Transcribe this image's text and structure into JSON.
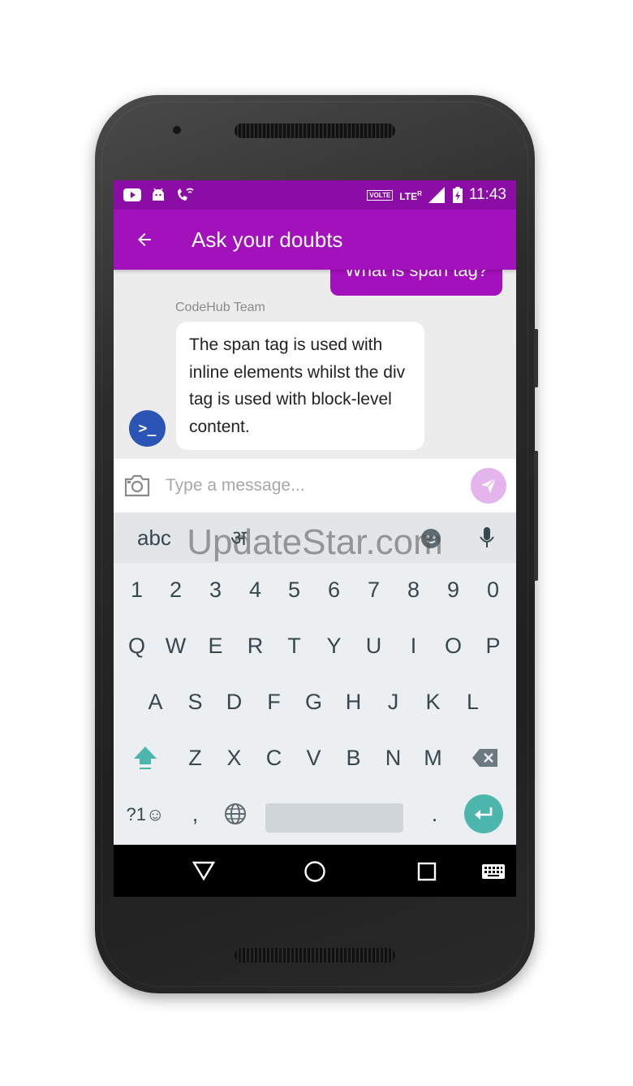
{
  "status_bar": {
    "left_icons": [
      "youtube-icon",
      "android-icon",
      "wifi-calling-icon"
    ],
    "volte": "VOLTE",
    "network": "LTE",
    "roaming": "R",
    "time": "11:43"
  },
  "app_bar": {
    "title": "Ask your doubts"
  },
  "chat": {
    "outgoing_message": "What is span tag?",
    "sender_name": "CodeHub Team",
    "incoming_message": "The span tag is used with inline elements whilst the div tag is used with block-level content.",
    "avatar_symbol": ">_"
  },
  "input": {
    "placeholder": "Type a message..."
  },
  "keyboard": {
    "toolbar": {
      "abc": "abc",
      "hindi": "अ"
    },
    "watermark": "UpdateStar.com",
    "number_row": [
      "1",
      "2",
      "3",
      "4",
      "5",
      "6",
      "7",
      "8",
      "9",
      "0"
    ],
    "row1": [
      "Q",
      "W",
      "E",
      "R",
      "T",
      "Y",
      "U",
      "I",
      "O",
      "P"
    ],
    "row2": [
      "A",
      "S",
      "D",
      "F",
      "G",
      "H",
      "J",
      "K",
      "L"
    ],
    "row3": [
      "Z",
      "X",
      "C",
      "V",
      "B",
      "N",
      "M"
    ],
    "bottom": {
      "symbols": "?1☺",
      "comma": ",",
      "period": "."
    }
  },
  "colors": {
    "status_bar": "#8b0da6",
    "app_bar": "#a311bd",
    "avatar": "#2a55b5",
    "send_button": "#e4b5ed",
    "enter_key": "#4db6ac",
    "shift_key": "#4db6ac"
  }
}
